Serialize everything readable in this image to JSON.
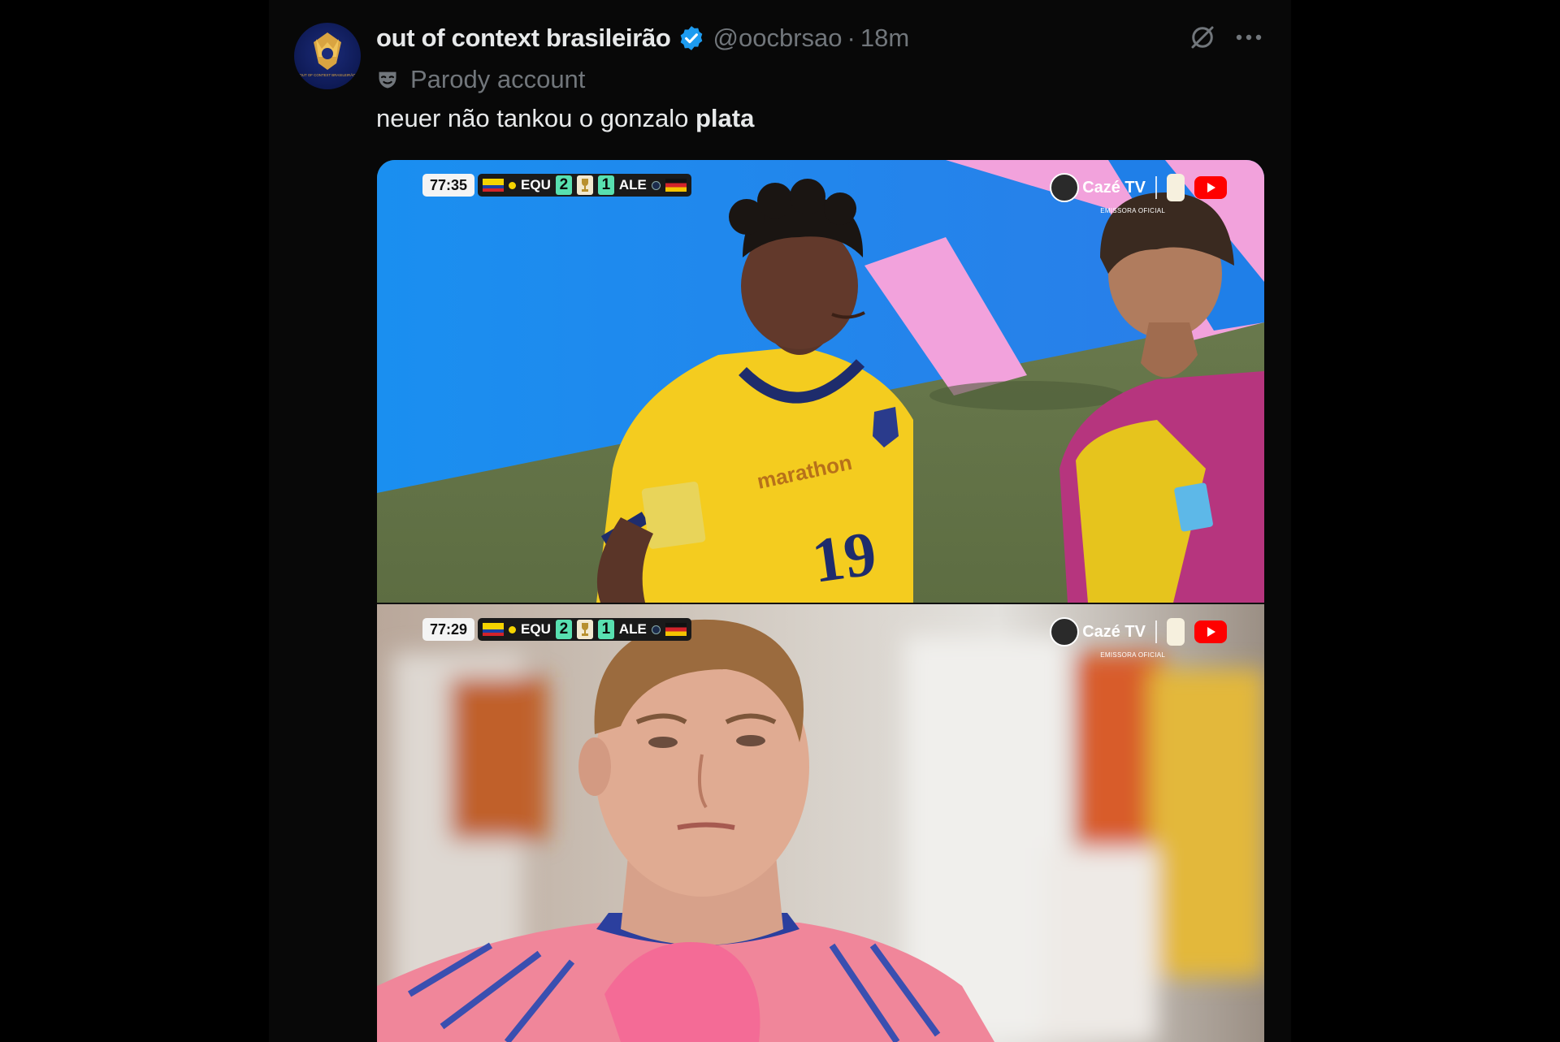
{
  "tweet": {
    "display_name": "out of context brasileirão",
    "handle": "@oocbrsao",
    "separator": "·",
    "time": "18m",
    "label": "Parody account",
    "text_plain": "neuer não tankou o gonzalo ",
    "text_bold": "plata",
    "avatar_text": "OUT OF CONTEXT BRASILEIRÃO"
  },
  "media": {
    "top": {
      "clock": "77:35",
      "home": "EQU",
      "home_score": "2",
      "away": "ALE",
      "away_score": "1",
      "jersey_number": "19",
      "shirt_sponsor": "marathon"
    },
    "bottom": {
      "clock": "77:29",
      "home": "EQU",
      "home_score": "2",
      "away": "ALE",
      "away_score": "1"
    },
    "brand": {
      "channel": "Cazé TV",
      "caption": "EMISSORA OFICIAL"
    }
  },
  "colors": {
    "background": "#000000",
    "column": "#080808",
    "primary_text": "#e7e9ea",
    "secondary_text": "#71767b",
    "verified_blue": "#1d9bf0",
    "score_teal": "#58e0b0"
  },
  "icons": [
    "verified-badge-icon",
    "parody-mask-icon",
    "grok-icon",
    "more-icon",
    "youtube-icon",
    "trophy-icon"
  ]
}
